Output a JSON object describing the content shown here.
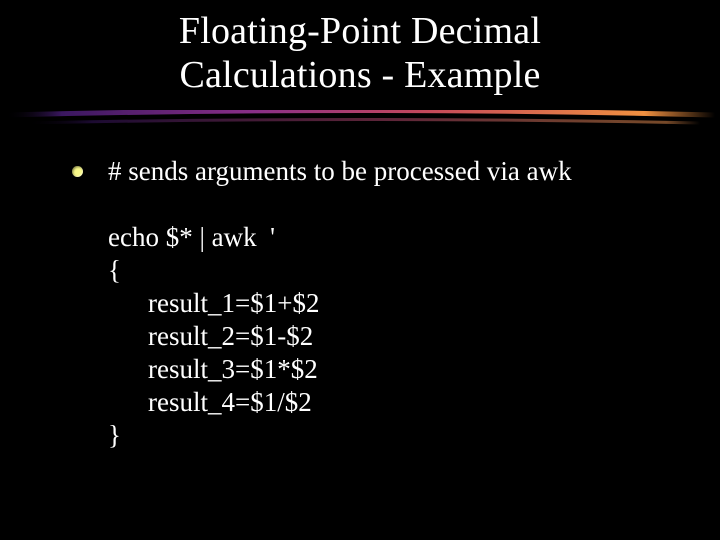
{
  "title_line1": "Floating-Point Decimal",
  "title_line2": "Calculations - Example",
  "comment": "# sends arguments to be processed via awk",
  "code": {
    "l1": "echo $* | awk  '",
    "l2": "{",
    "l3": "result_1=$1+$2",
    "l4": "result_2=$1-$2",
    "l5": "result_3=$1*$2",
    "l6": "result_4=$1/$2",
    "l7": "}"
  },
  "accent_gradient": {
    "from": "#551a8b",
    "mid": "#b0306a",
    "to": "#f08030"
  }
}
